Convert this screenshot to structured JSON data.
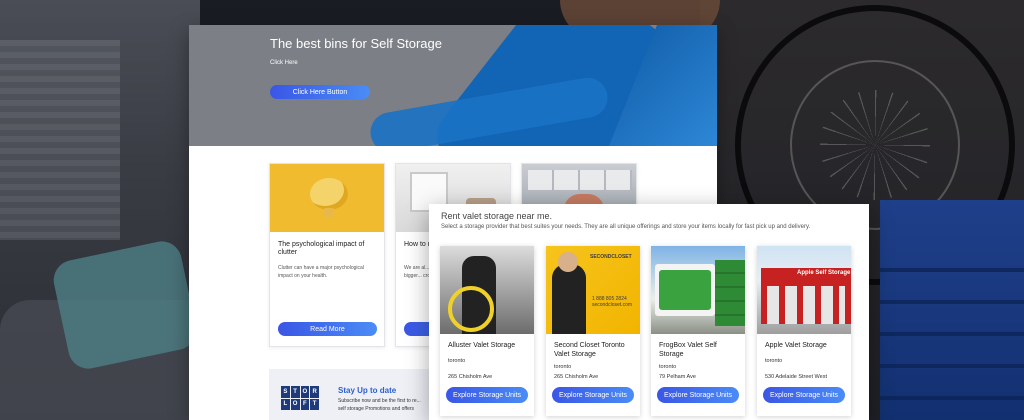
{
  "hero": {
    "title": "The best bins for Self Storage",
    "link": "Click Here",
    "button": "Click Here Button"
  },
  "blog": {
    "cards": [
      {
        "title": "The psychological impact of clutter",
        "text": "Clutter can have a major psychological impact on your health.",
        "button": "Read More"
      },
      {
        "title": "How to m... room lo...",
        "text": "We are al... room and... will totally... are bigger... crowding ...",
        "button": "Read More"
      },
      {
        "title": "",
        "text": "",
        "button": ""
      }
    ]
  },
  "newsletter": {
    "logo": [
      "S",
      "T",
      "O",
      "R",
      "L",
      "O",
      "F",
      "T"
    ],
    "title": "Stay Up to date",
    "text": "Subscribe now and be the first to re... self storage Promotions and offers"
  },
  "valet": {
    "title": "Rent valet storage near me.",
    "subtitle": "Select a storage provider that best suites your needs. They are all unique offerings and store your items locally for fast pick up and delivery.",
    "providers": [
      {
        "name": "Alluster Valet Storage",
        "city": "toronto",
        "address": "265 Chisholm Ave",
        "button": "Explore Storage Units"
      },
      {
        "name": "Second Closet Toronto Valet Storage",
        "city": "toronto",
        "address": "265 Chisholm Ave",
        "button": "Explore Storage Units",
        "image_text": "SECONDCLOSET",
        "image_phone": "1 888 805 2824 secondcloset.com"
      },
      {
        "name": "FrogBox Valet Self Storage",
        "city": "toronto",
        "address": "79 Pelham Ave",
        "button": "Explore Storage Units"
      },
      {
        "name": "Apple Valet Storage",
        "city": "toronto",
        "address": "530 Adelaide Street West",
        "button": "Explore Storage Units",
        "image_text": "Apple Self Storage"
      }
    ]
  },
  "colors": {
    "accent": "#3a56e6",
    "hero_blue": "#1264b5",
    "news_title": "#2c5fcf"
  }
}
